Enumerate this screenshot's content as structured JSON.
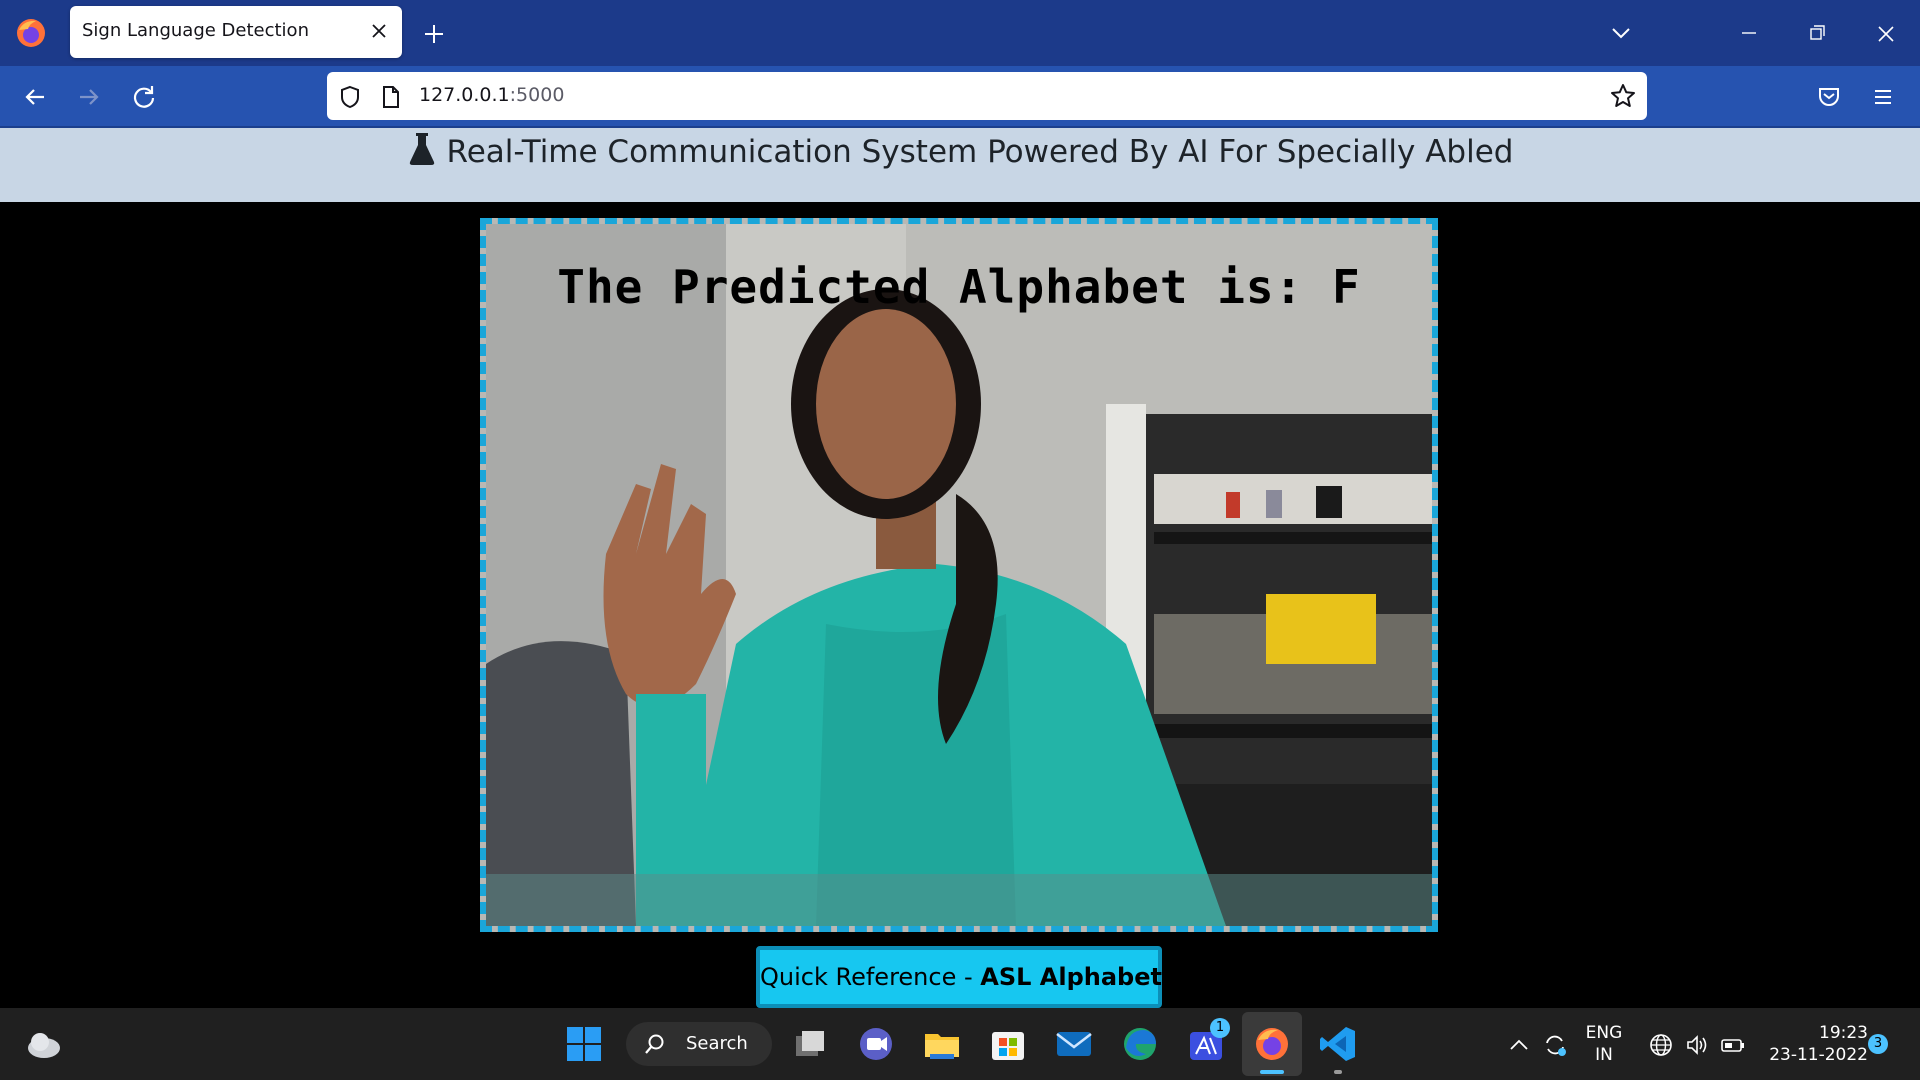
{
  "browser": {
    "tab_title": "Sign Language Detection",
    "url_host": "127.0.0.1",
    "url_port": ":5000"
  },
  "page": {
    "header_title": "Real-Time Communication System Powered By AI For Specially Abled",
    "prediction_text": "The Predicted Alphabet is: F",
    "quick_ref_prefix": "Quick Reference - ",
    "quick_ref_bold": "ASL Alphabets",
    "accent_color": "#17c7f0",
    "frame_border_color": "#1aa6d9"
  },
  "taskbar": {
    "search_label": "Search",
    "teams_badge": "1",
    "lang_primary": "ENG",
    "lang_secondary": "IN",
    "time": "19:23",
    "date": "23-11-2022",
    "notification_count": "3",
    "pinned_icons": [
      "windows-start-icon",
      "task-view-icon",
      "teams-chat-icon",
      "file-explorer-icon",
      "microsoft-store-icon",
      "mail-icon",
      "edge-icon",
      "app-icon",
      "firefox-icon",
      "vscode-icon"
    ]
  }
}
